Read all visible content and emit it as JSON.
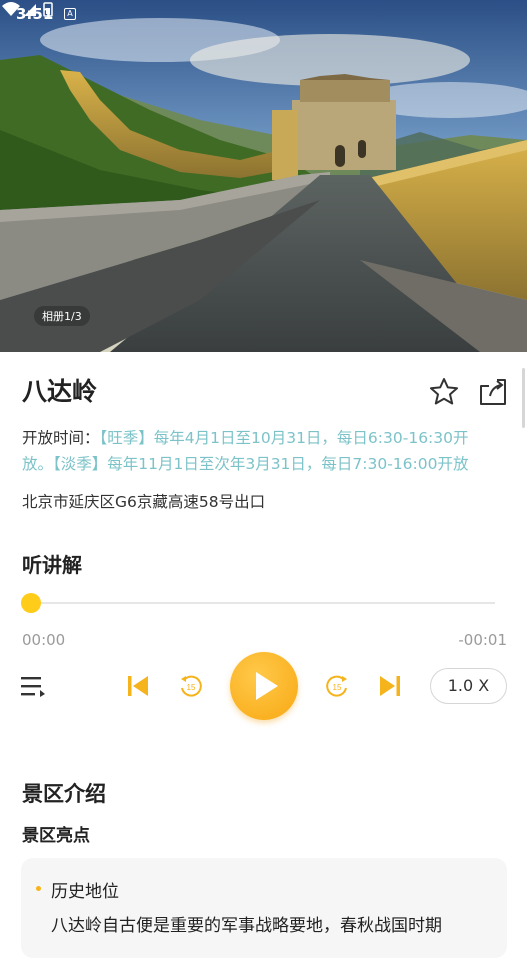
{
  "status_bar": {
    "time": "3:51",
    "notification_icon": "A",
    "icons": [
      "wifi-icon",
      "signal-icon",
      "battery-icon"
    ]
  },
  "hero": {
    "album_counter": "相册1/3",
    "image_subject": "great-wall-photo"
  },
  "attraction": {
    "title": "八达岭",
    "hours_label": "开放时间：",
    "hours_value": "【旺季】每年4月1日至10月31日，每日6:30-16:30开放。【淡季】每年11月1日至次年3月31日，每日7:30-16:00开放",
    "address": "北京市延庆区G6京藏高速58号出口"
  },
  "audio": {
    "section_title": "听讲解",
    "current_time": "00:00",
    "total_time": "-00:01",
    "progress": 0,
    "speed_label": "1.0 X"
  },
  "intro": {
    "section_title": "景区介绍",
    "highlights_title": "景区亮点",
    "card": {
      "heading": "历史地位",
      "text": "八达岭自古便是重要的军事战略要地，春秋战国时期"
    }
  },
  "colors": {
    "accent": "#f8a812",
    "hours_text": "#7cc3c9",
    "thumb": "#ffcc1a"
  }
}
